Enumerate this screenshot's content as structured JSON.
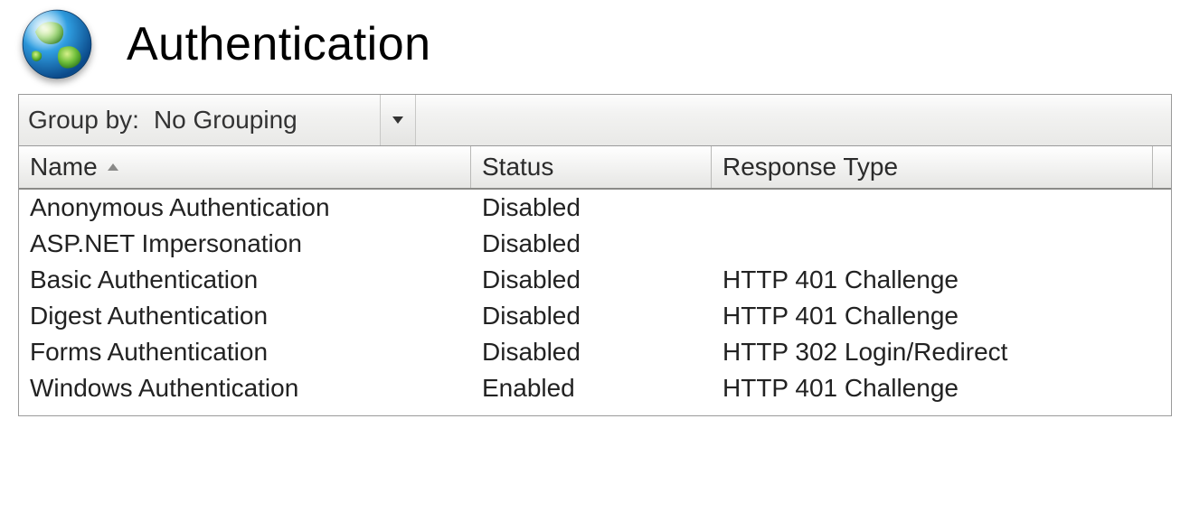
{
  "header": {
    "title": "Authentication",
    "icon": "globe-icon"
  },
  "toolbar": {
    "group_by_label": "Group by:",
    "group_by_value": "No Grouping"
  },
  "columns": {
    "name": "Name",
    "status": "Status",
    "response_type": "Response Type",
    "sorted_by": "name",
    "sort_dir": "asc"
  },
  "rows": [
    {
      "name": "Anonymous Authentication",
      "status": "Disabled",
      "response_type": ""
    },
    {
      "name": "ASP.NET Impersonation",
      "status": "Disabled",
      "response_type": ""
    },
    {
      "name": "Basic Authentication",
      "status": "Disabled",
      "response_type": "HTTP 401 Challenge"
    },
    {
      "name": "Digest Authentication",
      "status": "Disabled",
      "response_type": "HTTP 401 Challenge"
    },
    {
      "name": "Forms Authentication",
      "status": "Disabled",
      "response_type": "HTTP 302 Login/Redirect"
    },
    {
      "name": "Windows Authentication",
      "status": "Enabled",
      "response_type": "HTTP 401 Challenge"
    }
  ]
}
